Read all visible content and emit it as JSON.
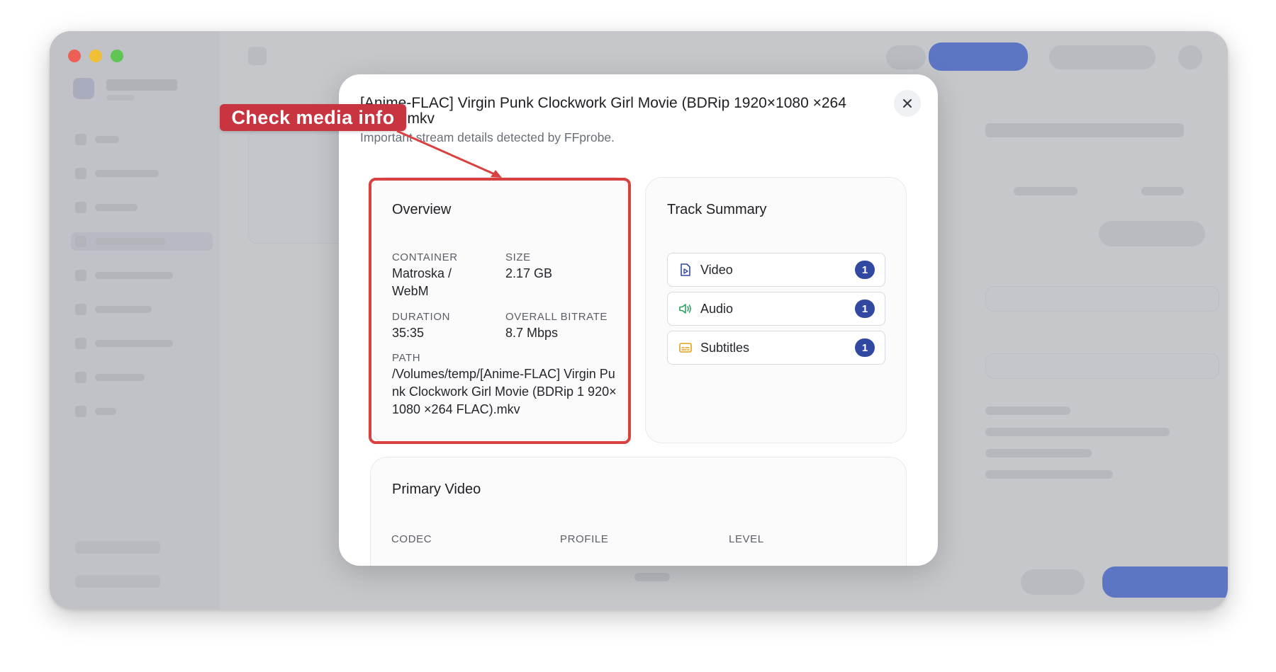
{
  "modal": {
    "title": "[Anime-FLAC] Virgin Punk Clockwork Girl Movie (BDRip 1920×1080 ×264 FLAC).mkv",
    "subtitle": "Important stream details detected by FFprobe.",
    "close_icon": "close-icon"
  },
  "overview": {
    "title": "Overview",
    "container_label": "CONTAINER",
    "container_value": "Matroska / WebM",
    "size_label": "SIZE",
    "size_value": "2.17 GB",
    "duration_label": "DURATION",
    "duration_value": "35:35",
    "bitrate_label": "OVERALL BITRATE",
    "bitrate_value": "8.7 Mbps",
    "path_label": "PATH",
    "path_value": "/Volumes/temp/[Anime-FLAC] Virgin Punk Clockwork Girl Movie (BDRip 1 920×1080 ×264 FLAC).mkv"
  },
  "track_summary": {
    "title": "Track Summary",
    "tracks": [
      {
        "label": "Video",
        "count": "1",
        "icon": "video-file-icon",
        "color": "#3048a0"
      },
      {
        "label": "Audio",
        "count": "1",
        "icon": "speaker-icon",
        "color": "#2f9e64"
      },
      {
        "label": "Subtitles",
        "count": "1",
        "icon": "subtitles-icon",
        "color": "#e2a11d"
      }
    ]
  },
  "primary_video": {
    "title": "Primary Video",
    "codec_label": "CODEC",
    "profile_label": "PROFILE",
    "level_label": "LEVEL"
  },
  "annotation": {
    "text": "Check media info",
    "color": "#c8343f"
  }
}
